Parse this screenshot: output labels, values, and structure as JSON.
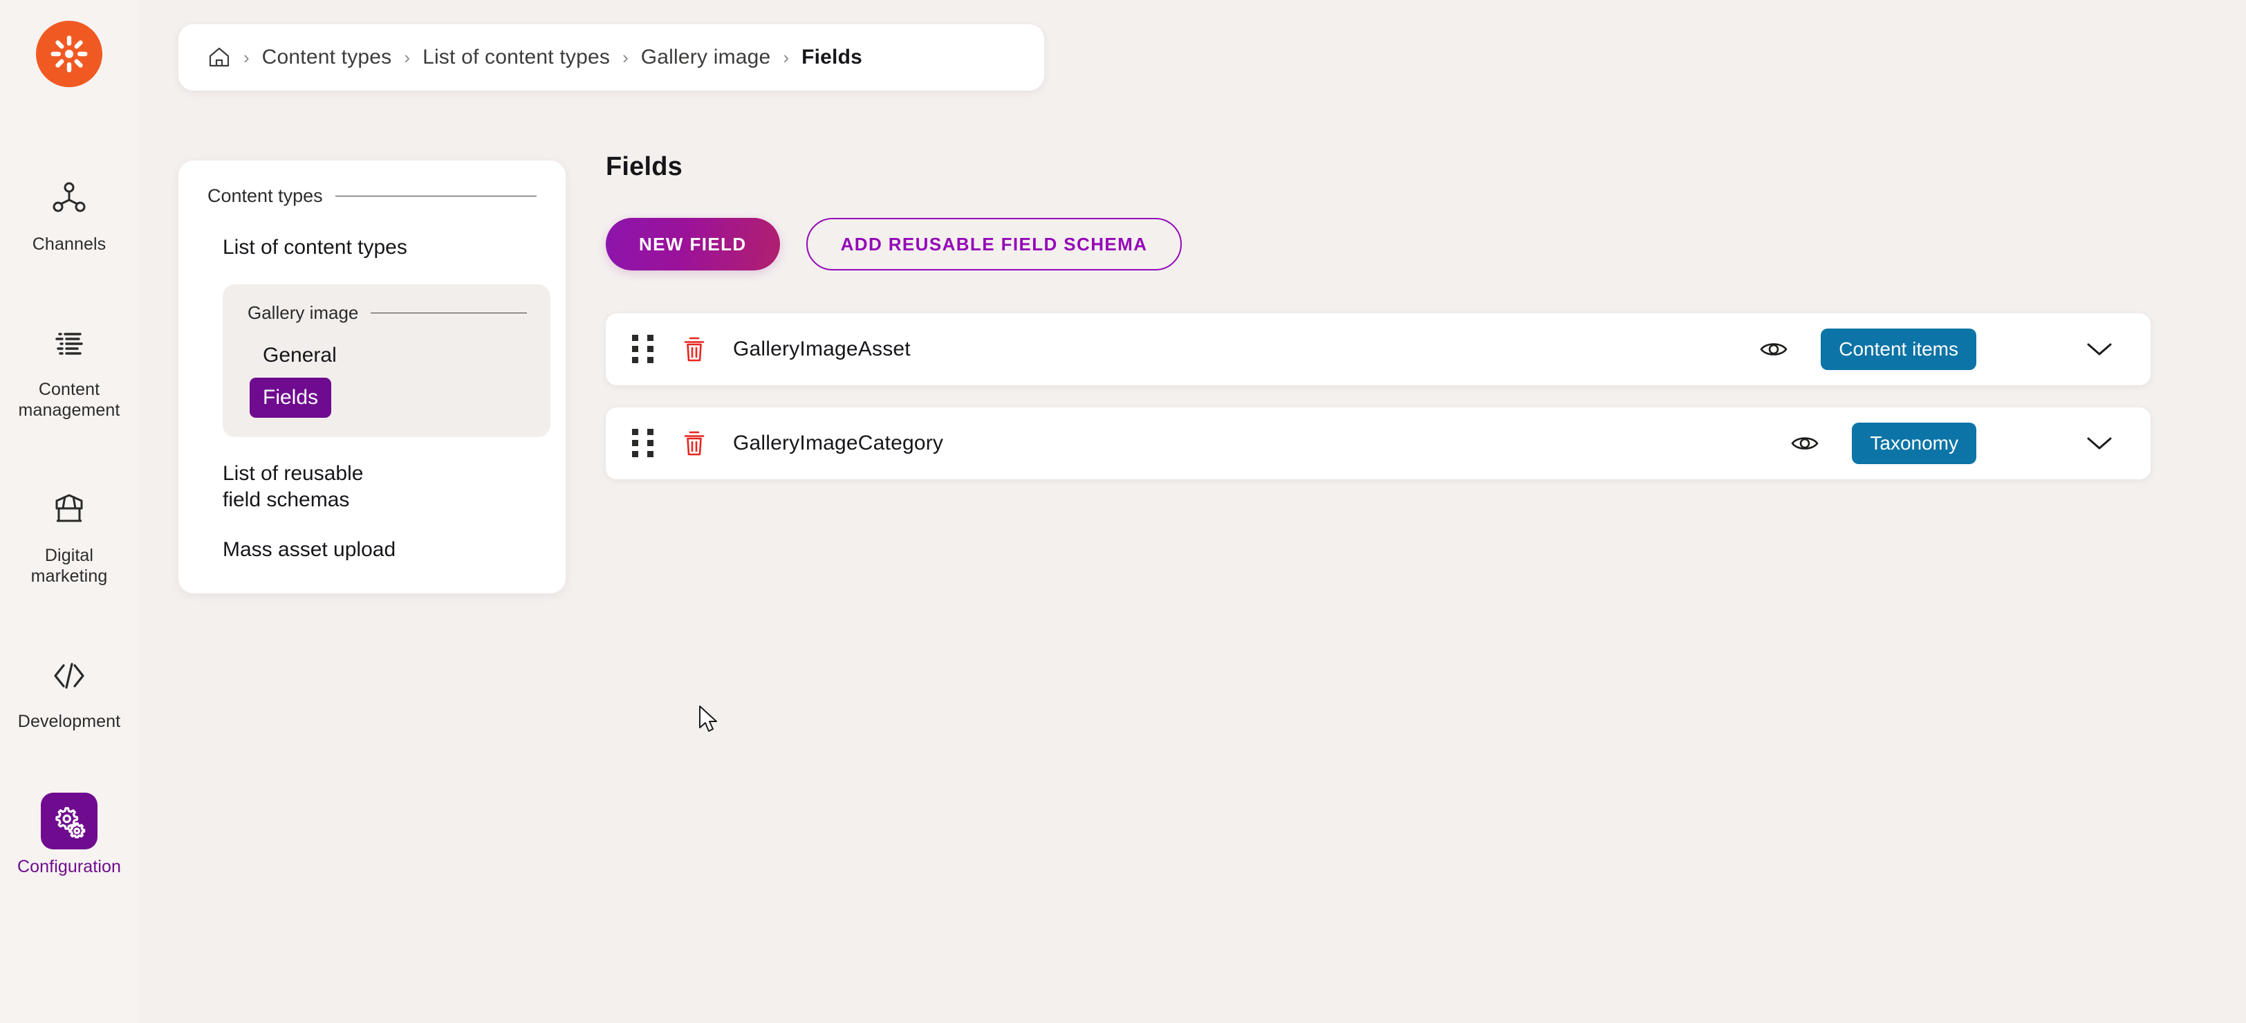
{
  "brand": {
    "logo_icon": "kentico-sun-logo",
    "color": "#f05a22"
  },
  "rail": {
    "items": [
      {
        "label": "Channels",
        "icon": "channels-network-icon",
        "active": false
      },
      {
        "label": "Content management",
        "icon": "content-lines-icon",
        "active": false
      },
      {
        "label": "Digital marketing",
        "icon": "storefront-icon",
        "active": false
      },
      {
        "label": "Development",
        "icon": "code-brackets-icon",
        "active": false
      },
      {
        "label": "Configuration",
        "icon": "gears-icon",
        "active": true
      }
    ],
    "active_color": "#6f0b8f"
  },
  "breadcrumb": {
    "home_icon": "home-icon",
    "separator": "›",
    "items": [
      {
        "label": "Content types",
        "current": false
      },
      {
        "label": "List of content types",
        "current": false
      },
      {
        "label": "Gallery image",
        "current": false
      },
      {
        "label": "Fields",
        "current": true
      }
    ]
  },
  "secondary_nav": {
    "section_title": "Content types",
    "links_before": [
      {
        "label": "List of content types"
      }
    ],
    "group": {
      "title": "Gallery image",
      "items": [
        {
          "label": "General",
          "active": false
        },
        {
          "label": "Fields",
          "active": true
        }
      ]
    },
    "links_after": [
      {
        "label": "List of reusable field schemas"
      },
      {
        "label": "Mass asset upload"
      }
    ]
  },
  "main": {
    "title": "Fields",
    "actions": {
      "primary_label": "NEW FIELD",
      "secondary_label": "ADD REUSABLE FIELD SCHEMA",
      "primary_gradient_from": "#8c15ad",
      "primary_gradient_to": "#b1206e",
      "secondary_color": "#9408b7"
    },
    "field_rows": [
      {
        "name": "GalleryImageAsset",
        "drag_icon": "drag-handle-icon",
        "delete_icon": "trash-icon",
        "delete_color": "#e8251f",
        "visibility_icon": "eye-icon",
        "badge_label": "Content items",
        "badge_color": "#0c74a6",
        "expand_icon": "chevron-down-icon"
      },
      {
        "name": "GalleryImageCategory",
        "drag_icon": "drag-handle-icon",
        "delete_icon": "trash-icon",
        "delete_color": "#e8251f",
        "visibility_icon": "eye-icon",
        "badge_label": "Taxonomy",
        "badge_color": "#0c74a6",
        "expand_icon": "chevron-down-icon"
      }
    ]
  },
  "cursor": {
    "icon": "mouse-pointer"
  }
}
